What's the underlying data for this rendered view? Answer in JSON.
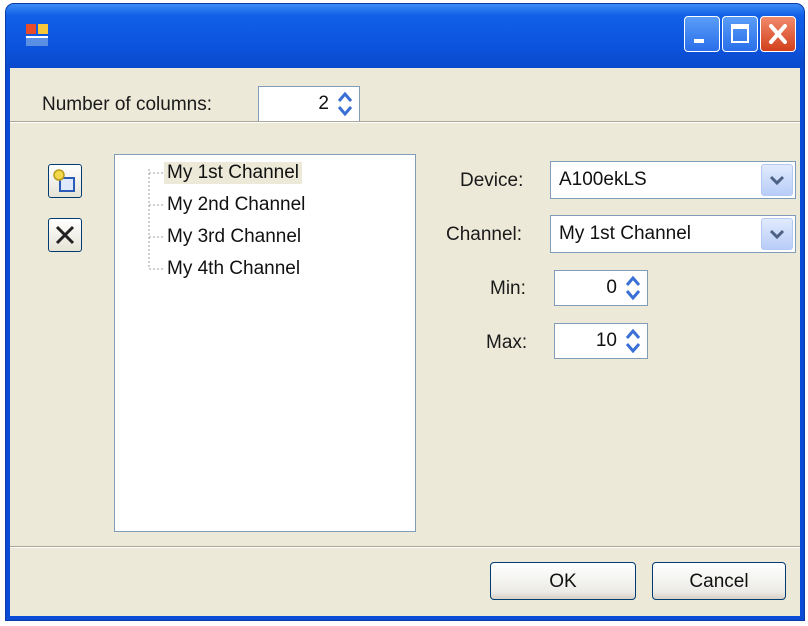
{
  "columns": {
    "label": "Number of columns:",
    "value": "2"
  },
  "channels": [
    "My 1st Channel",
    "My 2nd Channel",
    "My 3rd Channel",
    "My 4th Channel"
  ],
  "fields": {
    "device_label": "Device:",
    "device_value": "A100ekLS",
    "channel_label": "Channel:",
    "channel_value": "My 1st Channel",
    "min_label": "Min:",
    "min_value": "0",
    "max_label": "Max:",
    "max_value": "10"
  },
  "buttons": {
    "ok": "OK",
    "cancel": "Cancel"
  },
  "icons": {
    "app": "app-icon",
    "add": "add-channel-icon",
    "remove": "remove-x-icon",
    "minimize": "minimize-icon",
    "maximize": "maximize-icon",
    "close": "close-icon"
  },
  "colors": {
    "titlebar": "#0a49cc",
    "client": "#ece9d8",
    "close_button": "#d2401c"
  }
}
